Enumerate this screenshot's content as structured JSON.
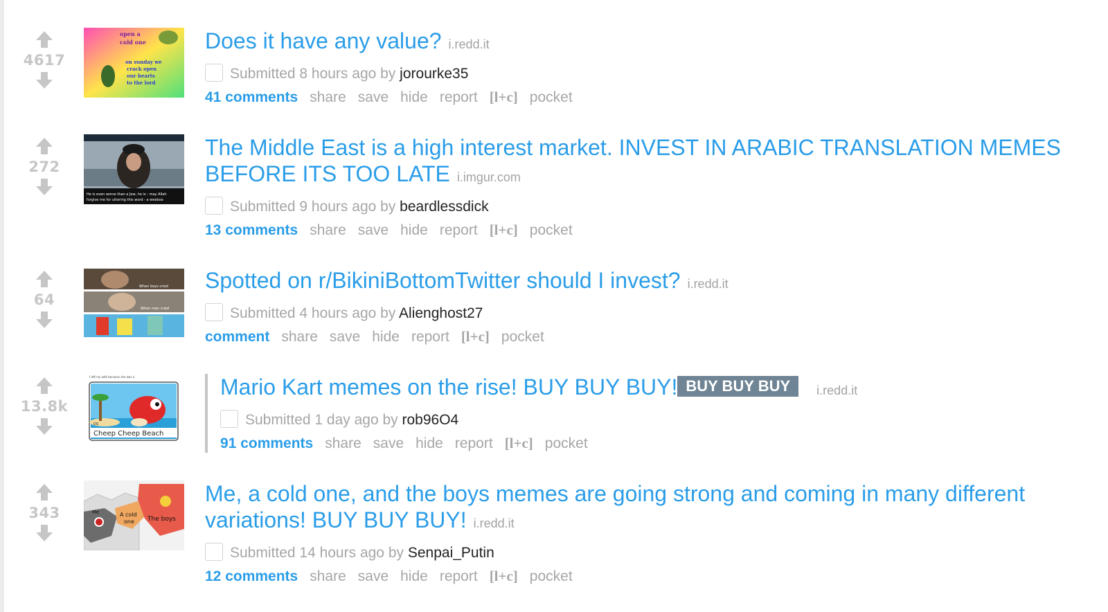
{
  "posts": [
    {
      "score": "4617",
      "title": "Does it have any value?",
      "flair": "",
      "domain": "i.redd.it",
      "submitted_prefix": "Submitted 8 hours ago by",
      "author": "jorourke35",
      "comments": "41 comments",
      "thumb_text": [
        "open a",
        "cold one",
        "on sunday we",
        "crack open",
        "our hearts",
        "to the lord"
      ]
    },
    {
      "score": "272",
      "title": "The Middle East is a high interest market. INVEST IN ARABIC TRANSLATION MEMES BEFORE ITS TOO LATE",
      "flair": "",
      "domain": "i.imgur.com",
      "submitted_prefix": "Submitted 9 hours ago by",
      "author": "beardlessdick",
      "comments": "13 comments",
      "thumb_text": [
        "He is even worse than a Jew, he is - may Allah",
        "forgive me for uttering this word - a weeboo"
      ]
    },
    {
      "score": "64",
      "title": "Spotted on r/BikiniBottomTwitter should I invest?",
      "flair": "",
      "domain": "i.redd.it",
      "submitted_prefix": "Submitted 4 hours ago by",
      "author": "Alienghost27",
      "comments": "comment",
      "thumb_text": [
        "When boys cried",
        "When men cried"
      ]
    },
    {
      "score": "13.8k",
      "title": "Mario Kart memes on the rise! BUY BUY BUY!",
      "flair": "BUY BUY BUY",
      "domain": "i.redd.it",
      "submitted_prefix": "Submitted 1 day ago by",
      "author": "rob96O4",
      "comments": "91 comments",
      "thumb_text": [
        "I left my wife because she was a",
        "DS",
        "Cheep Cheep Beach"
      ]
    },
    {
      "score": "343",
      "title": "Me, a cold one, and the boys memes are going strong and coming in many different variations! BUY BUY BUY!",
      "flair": "",
      "domain": "i.redd.it",
      "submitted_prefix": "Submitted 14 hours ago by",
      "author": "Senpai_Putin",
      "comments": "12 comments",
      "thumb_text": [
        "Me",
        "A cold",
        "one",
        "The boys"
      ]
    }
  ],
  "actions": {
    "share": "share",
    "save": "save",
    "hide": "hide",
    "report": "report",
    "lc": "[l+c]",
    "pocket": "pocket"
  },
  "icons": {
    "upvote": "upvote-arrow-icon",
    "downvote": "downvote-arrow-icon"
  },
  "colors": {
    "link": "#2a9de8",
    "muted": "#a6a6a6",
    "score": "#c6c6c6",
    "flair_bg": "#6f8494"
  }
}
